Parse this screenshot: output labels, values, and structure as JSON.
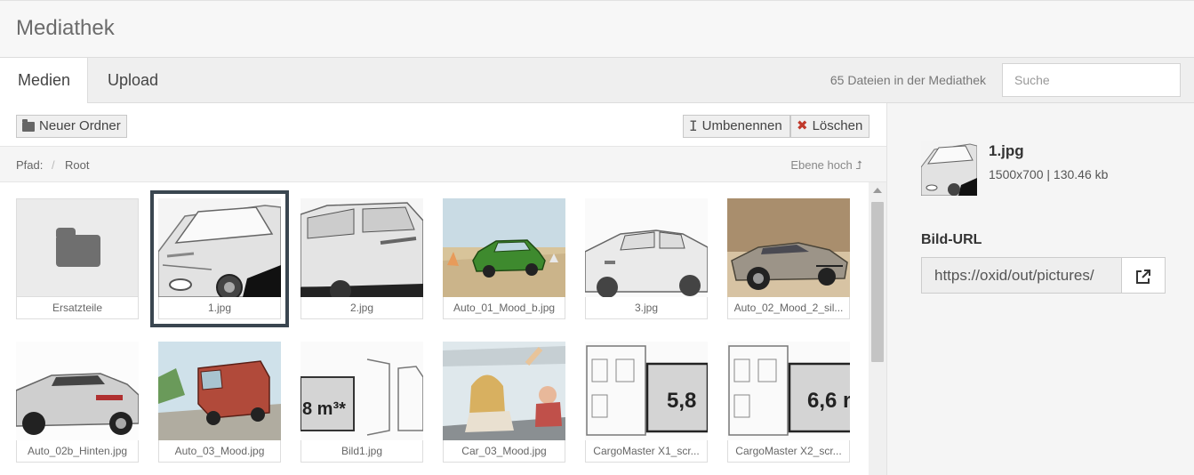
{
  "header": {
    "title": "Mediathek"
  },
  "tabs": [
    {
      "label": "Medien"
    },
    {
      "label": "Upload"
    }
  ],
  "file_count": "65 Dateien in der Mediathek",
  "search": {
    "placeholder": "Suche",
    "value": ""
  },
  "toolbar": {
    "new_folder": "Neuer Ordner",
    "rename": "Umbenennen",
    "delete": "Löschen"
  },
  "path": {
    "label": "Pfad:",
    "separator": "/",
    "root": "Root",
    "level_up": "Ebene hoch ⮥"
  },
  "items": [
    {
      "name": "Ersatzteile"
    },
    {
      "name": "1.jpg"
    },
    {
      "name": "2.jpg"
    },
    {
      "name": "Auto_01_Mood_b.jpg"
    },
    {
      "name": "3.jpg"
    },
    {
      "name": "Auto_02_Mood_2_sil..."
    },
    {
      "name": "Auto_02b_Hinten.jpg"
    },
    {
      "name": "Auto_03_Mood.jpg"
    },
    {
      "name": "Bild1.jpg"
    },
    {
      "name": "Car_03_Mood.jpg"
    },
    {
      "name": "CargoMaster X1_scr..."
    },
    {
      "name": "CargoMaster X2_scr..."
    }
  ],
  "thumb_labels": {
    "bild1": "8 m³*",
    "cargo1": "5,8",
    "cargo2": "6,6 m"
  },
  "details": {
    "name": "1.jpg",
    "meta": "1500x700 | 130.46 kb",
    "url_label": "Bild-URL",
    "url_value": "https://oxid/out/pictures/"
  },
  "colors": {
    "selected_border": "#3a4650",
    "delete_icon": "#c0392b"
  }
}
